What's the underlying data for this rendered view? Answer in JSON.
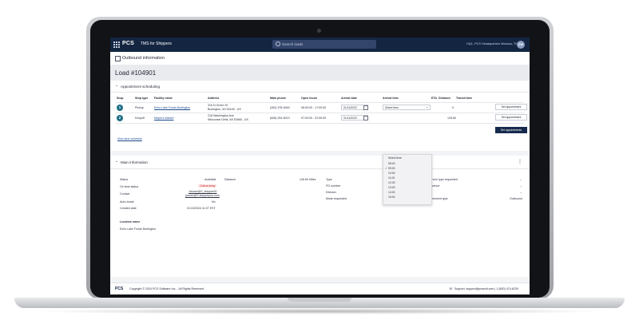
{
  "header": {
    "logo": "PCS",
    "app_name": "TMS for Shippers",
    "search_placeholder": "Search loads",
    "location": "HQ1- PCS Headquarters Wausau, TN",
    "avatar_initials": "ZW"
  },
  "page": {
    "title": "Outbound information",
    "load_title": "Load #104901"
  },
  "appointment": {
    "section_title": "Appointment scheduling",
    "columns": [
      "Stop",
      "Stop type",
      "Facility name",
      "Address",
      "Main phone",
      "Open hours",
      "Arrival date",
      "Arrival time",
      "ETA",
      "Distance",
      "Transit time"
    ],
    "rows": [
      {
        "stop": "1",
        "stop_type": "Pickup",
        "facility": "Echo Lake Foods Burlington",
        "address_1": "316 N Green St",
        "address_2": "Burlington, WI 53105 - US",
        "phone": "(262) 378-9040",
        "hours": "06:00:00 - 17:00:00",
        "arrival_date": "01/14/2022",
        "arrival_time": "Select time",
        "distance": "0",
        "button": "Set appointment"
      },
      {
        "stop": "2",
        "stop_type": "Dropoff",
        "facility": "Mayer's Market",
        "address_1": "218 Washington Ave",
        "address_2": "Wisconsin Dells, WI 53965 - US",
        "phone": "(608) 254-8213",
        "hours": "07:00:00 - 22:00:00",
        "arrival_date": "01/14/2022",
        "distance": "126.60",
        "button": "Set appointment"
      }
    ],
    "time_options": [
      "Select time",
      "08:00",
      "09:00",
      "10:00",
      "11:00",
      "12:00",
      "13:00",
      "14:00",
      "15:00"
    ],
    "selected_time": "09:00",
    "set_appointments_button": "Set appointments",
    "view_link": "View lane schedule"
  },
  "main_info": {
    "section_title": "Main information",
    "col1": [
      {
        "label": "Status",
        "value": "Available"
      },
      {
        "label": "On time status",
        "value": "Critical delay"
      },
      {
        "label": "Contact",
        "value": "Jdoose@S_shipper00",
        "value2": "jdoose@S.shipperpcs.com"
      },
      {
        "label": "Auto-tnotal",
        "value": "No"
      },
      {
        "label": "Created date",
        "value": "01/13/2024 11:07 EST"
      }
    ],
    "col2": [
      {
        "label": "Distance",
        "value": "126.60 Miles"
      }
    ],
    "col3": [
      {
        "label": "Type",
        "value": "Outbound"
      },
      {
        "label": "PO number",
        "value": "--"
      },
      {
        "label": "Division",
        "value": "--"
      },
      {
        "label": "Mode requested",
        "value": "--"
      }
    ],
    "col4": [
      {
        "label": "Service type requested",
        "value": "--"
      },
      {
        "label": "Revenue",
        "value": "--"
      },
      {
        "label": "BU",
        "value": "--"
      },
      {
        "label": "Movement type",
        "value": "Outbound"
      }
    ],
    "location_label": "Location name",
    "location_value": "Echo Lake Foods Burlington"
  },
  "footer": {
    "logo": "PCS",
    "copyright": "Copyright © 2024 PCS Software Inc. - All Rights Reserved.",
    "support": "Support: support@pcssoft.com | 1 (800) 474-6239"
  }
}
